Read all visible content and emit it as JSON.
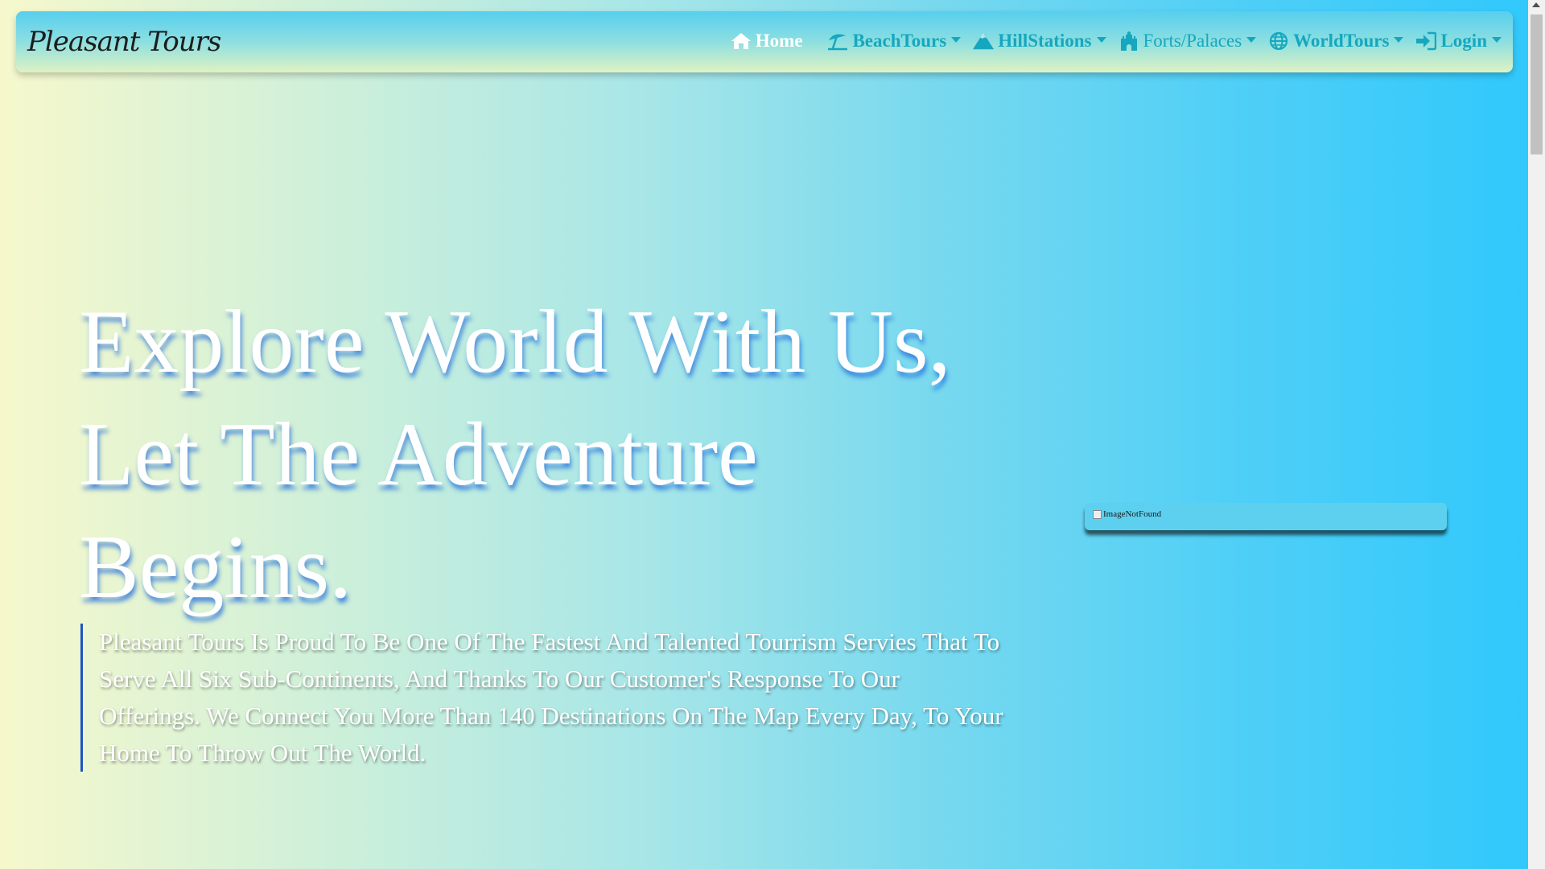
{
  "brand": "Pleasant Tours",
  "nav": {
    "home": "Home",
    "beach": "BeachTours",
    "hills": "HillStations",
    "forts": "Forts/Palaces",
    "world": "WorldTours",
    "login": "Login"
  },
  "hero": {
    "line1": "Explore World With Us,",
    "line2": "Let The Adventure",
    "line3": "Begins.",
    "description": "Pleasant Tours Is Proud To Be One Of The Fastest And Talented Tourrism Servies That To Serve All Six Sub-Continents, And Thanks To Our Customer's Response To Our Offerings. We Connect You More Than 140 Destinations On The Map Every Day, To Your Home To Throw Out The World."
  },
  "image": {
    "alt": "ImageNotFound"
  },
  "icons": [
    "home-icon",
    "beach-umbrella-icon",
    "mountain-icon",
    "fort-icon",
    "globe-icon",
    "sign-in-icon",
    "chevron-down-icon"
  ],
  "colors": {
    "nav_link": "#15a7bf",
    "nav_active": "#ffffff",
    "accent_border": "#1e55c4"
  }
}
